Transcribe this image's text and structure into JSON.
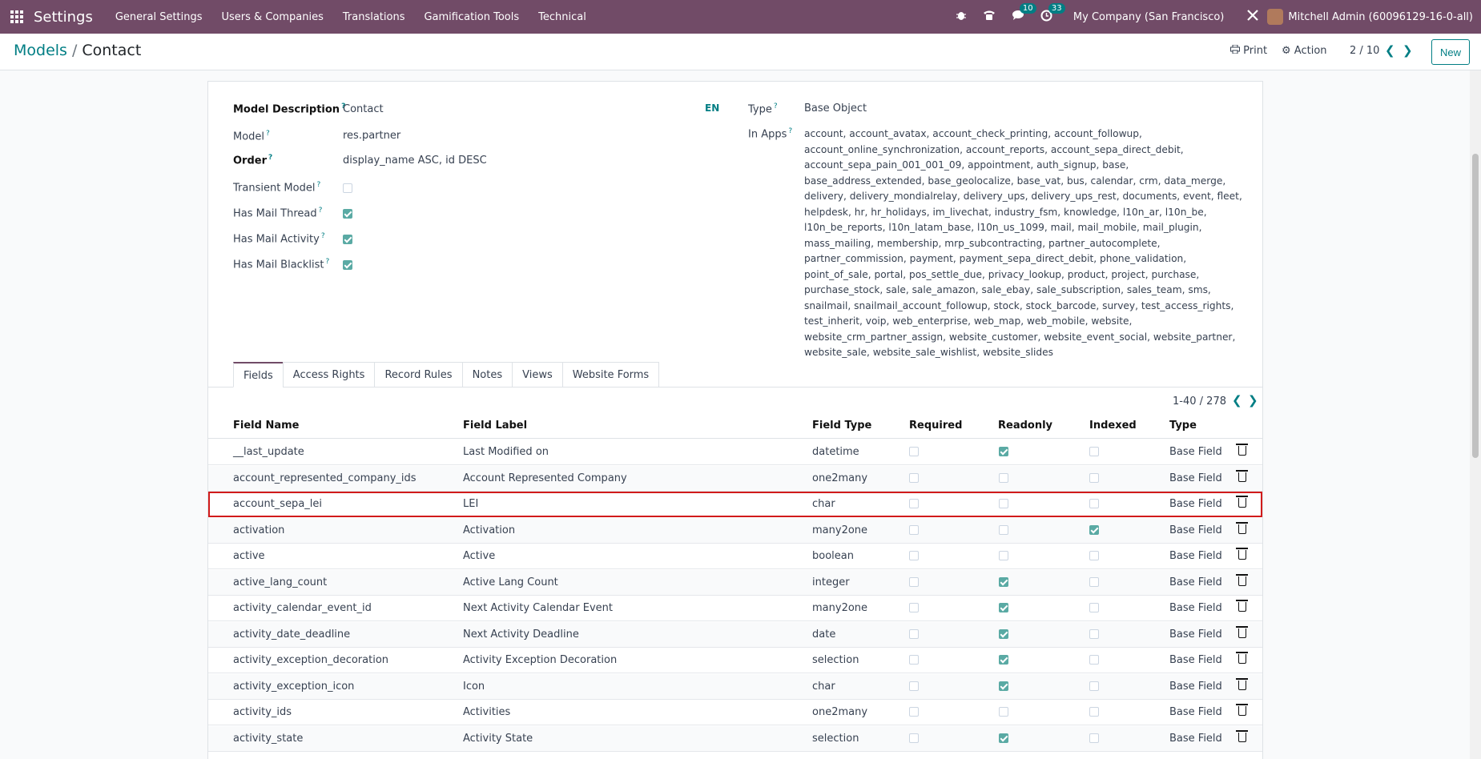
{
  "navbar": {
    "brand": "Settings",
    "menu": [
      "General Settings",
      "Users & Companies",
      "Translations",
      "Gamification Tools",
      "Technical"
    ],
    "messages_badge": "10",
    "activities_badge": "33",
    "company": "My Company (San Francisco)",
    "user": "Mitchell Admin (60096129-16-0-all)"
  },
  "control": {
    "breadcrumb_parent": "Models",
    "breadcrumb_sep": "/",
    "breadcrumb_current": "Contact",
    "print_label": "Print",
    "action_label": "Action",
    "pager": "2 / 10",
    "new_label": "New"
  },
  "form": {
    "model_description_label": "Model Description",
    "model_description": "Contact",
    "lang": "EN",
    "model_label": "Model",
    "model": "res.partner",
    "order_label": "Order",
    "order": "display_name ASC, id DESC",
    "transient_label": "Transient Model",
    "mail_thread_label": "Has Mail Thread",
    "mail_activity_label": "Has Mail Activity",
    "mail_blacklist_label": "Has Mail Blacklist",
    "type_label": "Type",
    "type": "Base Object",
    "in_apps_label": "In Apps",
    "in_apps": "account, account_avatax, account_check_printing, account_followup, account_online_synchronization, account_reports, account_sepa_direct_debit, account_sepa_pain_001_001_09, appointment, auth_signup, base, base_address_extended, base_geolocalize, base_vat, bus, calendar, crm, data_merge, delivery, delivery_mondialrelay, delivery_ups, delivery_ups_rest, documents, event, fleet, helpdesk, hr, hr_holidays, im_livechat, industry_fsm, knowledge, l10n_ar, l10n_be, l10n_be_reports, l10n_latam_base, l10n_us_1099, mail, mail_mobile, mail_plugin, mass_mailing, membership, mrp_subcontracting, partner_autocomplete, partner_commission, payment, payment_sepa_direct_debit, phone_validation, point_of_sale, portal, pos_settle_due, privacy_lookup, product, project, purchase, purchase_stock, sale, sale_amazon, sale_ebay, sale_subscription, sales_team, sms, snailmail, snailmail_account_followup, stock, stock_barcode, survey, test_access_rights, test_inherit, voip, web_enterprise, web_map, web_mobile, website, website_crm_partner_assign, website_customer, website_event_social, website_partner, website_sale, website_sale_wishlist, website_slides"
  },
  "tabs": [
    "Fields",
    "Access Rights",
    "Record Rules",
    "Notes",
    "Views",
    "Website Forms"
  ],
  "list": {
    "pager": "1-40 / 278",
    "headers": [
      "Field Name",
      "Field Label",
      "Field Type",
      "Required",
      "Readonly",
      "Indexed",
      "Type"
    ],
    "rows": [
      {
        "name": "__last_update",
        "label": "Last Modified on",
        "ftype": "datetime",
        "req": false,
        "ro": true,
        "idx": false,
        "type": "Base Field"
      },
      {
        "name": "account_represented_company_ids",
        "label": "Account Represented Company",
        "ftype": "one2many",
        "req": false,
        "ro": false,
        "idx": false,
        "type": "Base Field"
      },
      {
        "name": "account_sepa_lei",
        "label": "LEI",
        "ftype": "char",
        "req": false,
        "ro": false,
        "idx": false,
        "type": "Base Field"
      },
      {
        "name": "activation",
        "label": "Activation",
        "ftype": "many2one",
        "req": false,
        "ro": false,
        "idx": true,
        "type": "Base Field"
      },
      {
        "name": "active",
        "label": "Active",
        "ftype": "boolean",
        "req": false,
        "ro": false,
        "idx": false,
        "type": "Base Field"
      },
      {
        "name": "active_lang_count",
        "label": "Active Lang Count",
        "ftype": "integer",
        "req": false,
        "ro": true,
        "idx": false,
        "type": "Base Field"
      },
      {
        "name": "activity_calendar_event_id",
        "label": "Next Activity Calendar Event",
        "ftype": "many2one",
        "req": false,
        "ro": true,
        "idx": false,
        "type": "Base Field"
      },
      {
        "name": "activity_date_deadline",
        "label": "Next Activity Deadline",
        "ftype": "date",
        "req": false,
        "ro": true,
        "idx": false,
        "type": "Base Field"
      },
      {
        "name": "activity_exception_decoration",
        "label": "Activity Exception Decoration",
        "ftype": "selection",
        "req": false,
        "ro": true,
        "idx": false,
        "type": "Base Field"
      },
      {
        "name": "activity_exception_icon",
        "label": "Icon",
        "ftype": "char",
        "req": false,
        "ro": true,
        "idx": false,
        "type": "Base Field"
      },
      {
        "name": "activity_ids",
        "label": "Activities",
        "ftype": "one2many",
        "req": false,
        "ro": false,
        "idx": false,
        "type": "Base Field"
      },
      {
        "name": "activity_state",
        "label": "Activity State",
        "ftype": "selection",
        "req": false,
        "ro": true,
        "idx": false,
        "type": "Base Field"
      }
    ]
  }
}
